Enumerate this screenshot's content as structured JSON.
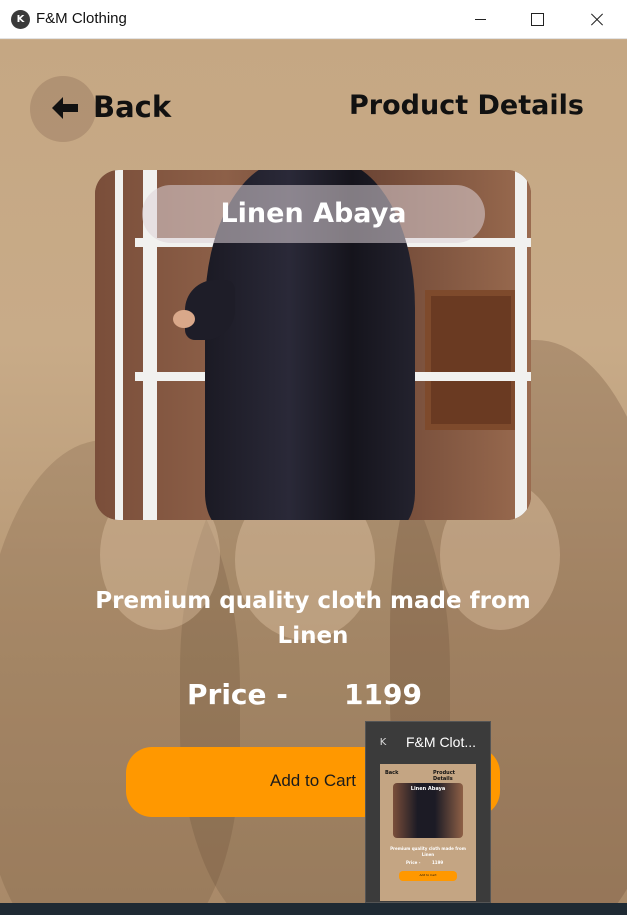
{
  "window": {
    "title": "F&M Clothing",
    "icon": "kivy-logo-icon"
  },
  "header": {
    "back_label": "Back",
    "page_title": "Product Details"
  },
  "product": {
    "name": "Linen Abaya",
    "description": "Premium quality cloth made from Linen",
    "price_label": "Price -",
    "price_value": "1199",
    "cart_button_label": "Add to Cart"
  },
  "taskbar_preview": {
    "title": "F&M Clot...",
    "thumbnail": {
      "back_label": "Back",
      "page_title": "Product Details",
      "product_name": "Linen Abaya",
      "description": "Premium quality cloth made from Linen",
      "price_label": "Price -",
      "price_value": "1199",
      "cart_button_label": "Add to Cart"
    }
  },
  "colors": {
    "accent": "#ff9800",
    "background": "#c8ab88"
  }
}
